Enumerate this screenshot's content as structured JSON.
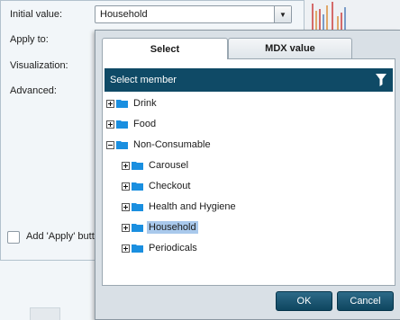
{
  "background_dialog": {
    "initial_value_label": "Initial value:",
    "initial_value_selected": "Household",
    "apply_to_label": "Apply to:",
    "visualization_label": "Visualization:",
    "advanced_label": "Advanced:",
    "add_apply_checkbox_label": "Add 'Apply' butto"
  },
  "popup": {
    "tabs": [
      {
        "label": "Select",
        "active": true
      },
      {
        "label": "MDX value",
        "active": false
      }
    ],
    "tree_header": "Select member",
    "tree_items": [
      {
        "label": "Drink",
        "level": 0,
        "expanded": false,
        "selected": false
      },
      {
        "label": "Food",
        "level": 0,
        "expanded": false,
        "selected": false
      },
      {
        "label": "Non-Consumable",
        "level": 0,
        "expanded": true,
        "selected": false
      },
      {
        "label": "Carousel",
        "level": 1,
        "expanded": false,
        "selected": false
      },
      {
        "label": "Checkout",
        "level": 1,
        "expanded": false,
        "selected": false
      },
      {
        "label": "Health and Hygiene",
        "level": 1,
        "expanded": false,
        "selected": false
      },
      {
        "label": "Household",
        "level": 1,
        "expanded": false,
        "selected": true
      },
      {
        "label": "Periodicals",
        "level": 1,
        "expanded": false,
        "selected": false
      }
    ],
    "ok_label": "OK",
    "cancel_label": "Cancel"
  },
  "colors": {
    "header_bg": "#0f4a66",
    "folder": "#1a8fe0",
    "selection": "#a9c9ec",
    "button": "#0e455f"
  },
  "icons": {
    "dropdown": "triangle-down-icon",
    "filter": "funnel-icon",
    "folder": "folder-icon"
  }
}
